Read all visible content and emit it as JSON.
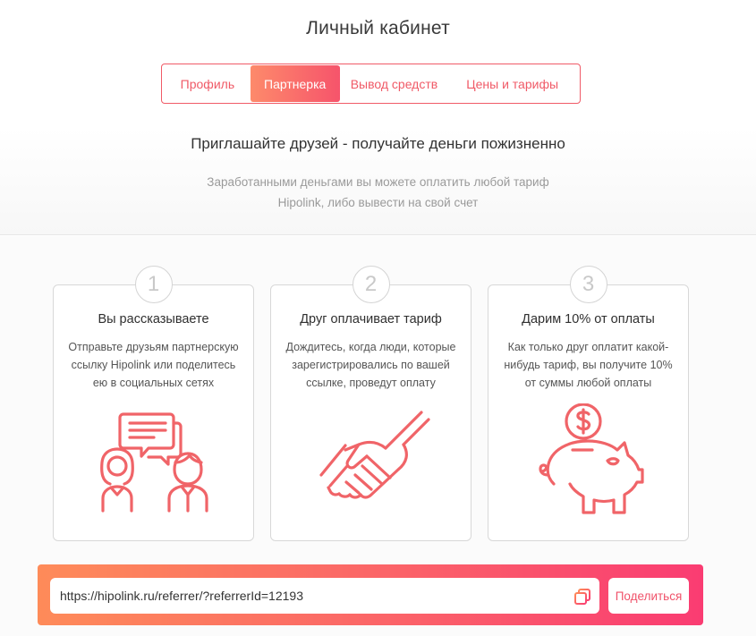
{
  "page": {
    "title": "Личный кабинет"
  },
  "tabs": [
    {
      "label": "Профиль"
    },
    {
      "label": "Партнерка"
    },
    {
      "label": "Вывод средств"
    },
    {
      "label": "Цены и тарифы"
    }
  ],
  "hero": {
    "title": "Приглашайте друзей - получайте деньги пожизненно",
    "subtitle_line1": "Заработанными деньгами вы можете оплатить любой тариф",
    "subtitle_line2": "Hipolink, либо вывести на свой счет"
  },
  "steps": [
    {
      "number": "1",
      "title": "Вы рассказываете",
      "line1": "Отправьте друзьям партнерскую",
      "line2": "ссылку Hipolink или поделитесь",
      "line3": "ею в социальных сетях",
      "icon": "people-chat-icon"
    },
    {
      "number": "2",
      "title": "Друг оплачивает тариф",
      "line1": "Дождитесь, когда люди, которые",
      "line2": "зарегистрировались по вашей",
      "line3": "ссылке, проведут оплату",
      "icon": "handshake-icon"
    },
    {
      "number": "3",
      "title": "Дарим 10% от оплаты",
      "line1": "Как только друг оплатит какой-",
      "line2": "нибудь тариф, вы получите 10%",
      "line3": "от суммы любой оплаты",
      "icon": "piggy-bank-icon"
    }
  ],
  "referral": {
    "link": "https://hipolink.ru/referrer/?referrerId=12193",
    "share_label": "Поделиться",
    "copy_icon": "copy-icon"
  },
  "colors": {
    "accent": "#f05a67",
    "gradient_start": "#fe8b59",
    "gradient_end": "#fa3c72"
  }
}
